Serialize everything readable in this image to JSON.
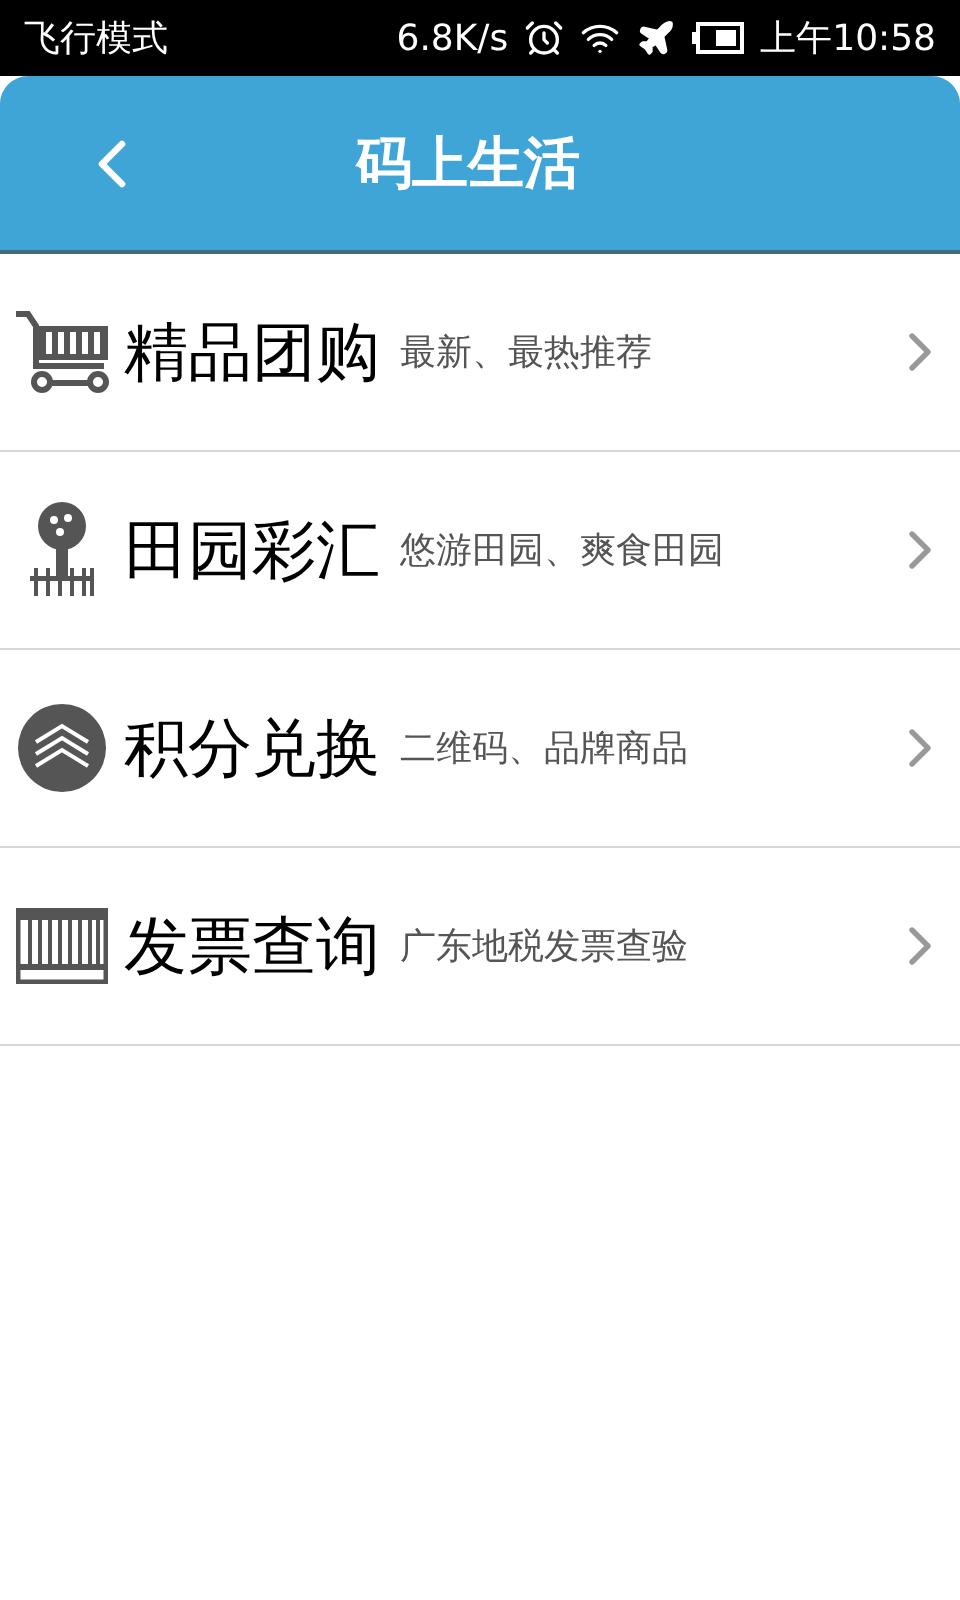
{
  "status_bar": {
    "mode": "飞行模式",
    "speed": "6.8K/s",
    "time": "上午10:58"
  },
  "header": {
    "title": "码上生活"
  },
  "items": [
    {
      "kind": "cart",
      "title": "精品团购",
      "subtitle": "最新、最热推荐"
    },
    {
      "kind": "tree",
      "title": "田园彩汇",
      "subtitle": "悠游田园、爽食田园"
    },
    {
      "kind": "coin",
      "title": "积分兑换",
      "subtitle": "二维码、品牌商品"
    },
    {
      "kind": "invoice",
      "title": "发票查询",
      "subtitle": "广东地税发票查验"
    }
  ]
}
